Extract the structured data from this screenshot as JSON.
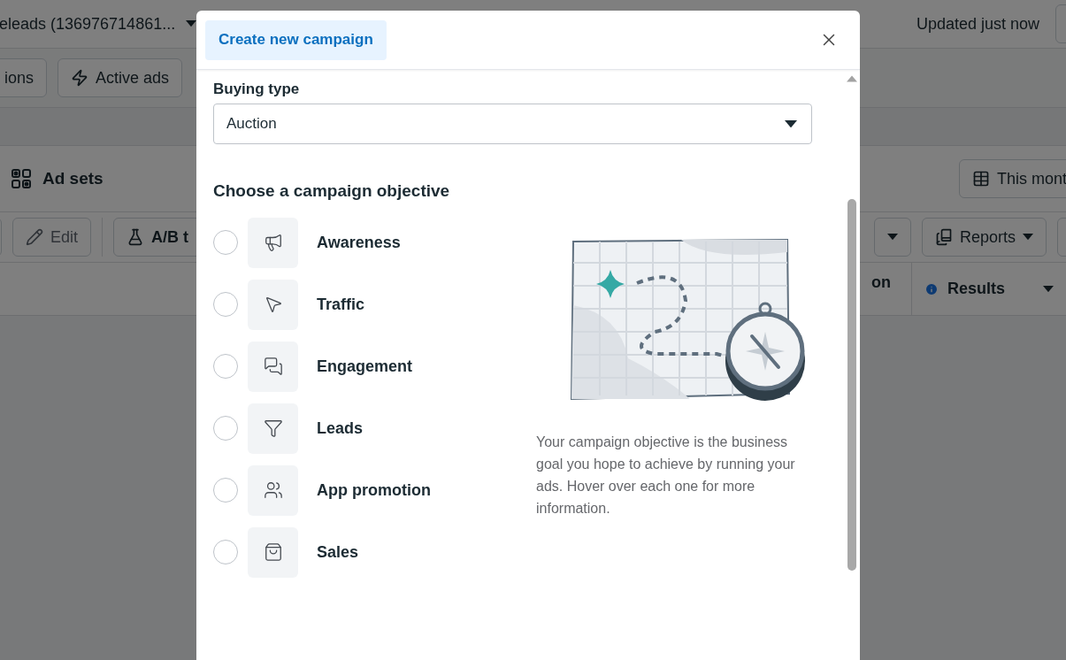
{
  "background": {
    "account_selector": "eleads (136976714861...",
    "update_status": "Updated just now",
    "filter_buttons": [
      {
        "label": "ions"
      },
      {
        "label": "Active ads"
      }
    ],
    "level_tab": {
      "label": "Ad sets"
    },
    "date_button": "This mont",
    "toolbar": {
      "edit": "Edit",
      "ab_test": "A/B t",
      "reports": "Reports"
    },
    "table_columns": [
      "on",
      "Results"
    ]
  },
  "dialog": {
    "tab": {
      "label": "Create new campaign",
      "selected": true
    },
    "buying_type": {
      "label": "Buying type",
      "value": "Auction"
    },
    "objective_heading": "Choose a campaign objective",
    "objectives": [
      {
        "label": "Awareness",
        "kind": "megaphone",
        "selected": false
      },
      {
        "label": "Traffic",
        "kind": "pointer",
        "selected": false
      },
      {
        "label": "Engagement",
        "kind": "chat",
        "selected": false
      },
      {
        "label": "Leads",
        "kind": "funnel",
        "selected": false
      },
      {
        "label": "App promotion",
        "kind": "people",
        "selected": false
      },
      {
        "label": "Sales",
        "kind": "bag",
        "selected": false
      }
    ],
    "description": "Your campaign objective is the business goal you hope to achieve by running your ads. Hover over each one for more information."
  }
}
